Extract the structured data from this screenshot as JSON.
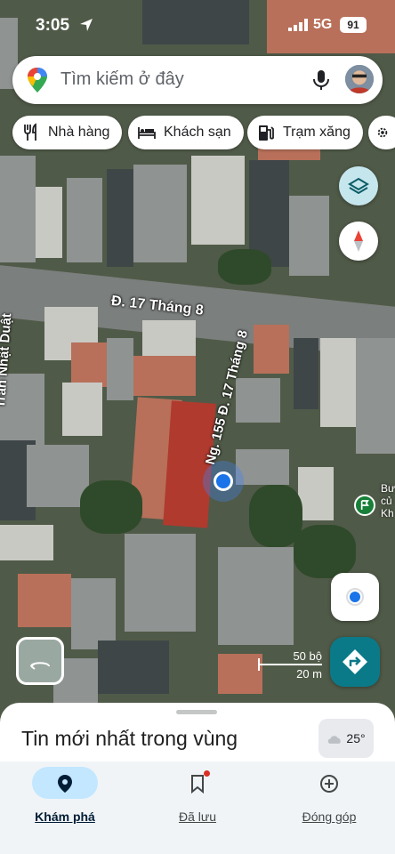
{
  "status_bar": {
    "time": "3:05",
    "network": "5G",
    "battery": "91"
  },
  "search": {
    "placeholder": "Tìm kiếm ở đây"
  },
  "chips": [
    {
      "label": "Nhà hàng",
      "icon": "fork-knife-icon"
    },
    {
      "label": "Khách sạn",
      "icon": "bed-icon"
    },
    {
      "label": "Trạm xăng",
      "icon": "gas-station-icon"
    }
  ],
  "map": {
    "streets": {
      "main": "Đ. 17 Tháng 8",
      "side": "Ng. 155 Đ. 17 Tháng 8",
      "left": "Trần Nhật Duật"
    },
    "poi_label": "Bư\ncủ\nKh",
    "scale": {
      "imperial": "50 bộ",
      "metric": "20 m"
    }
  },
  "sheet": {
    "title": "Tin mới nhất trong vùng",
    "weather": "25°"
  },
  "nav": [
    {
      "label": "Khám phá",
      "icon": "explore-pin-icon",
      "active": true
    },
    {
      "label": "Đã lưu",
      "icon": "bookmark-icon",
      "active": false
    },
    {
      "label": "Đóng góp",
      "icon": "add-circle-icon",
      "active": false
    }
  ],
  "colors": {
    "accent": "#0b7a88",
    "nav_active": "#c2e7ff",
    "blue_dot": "#1a73e8"
  }
}
